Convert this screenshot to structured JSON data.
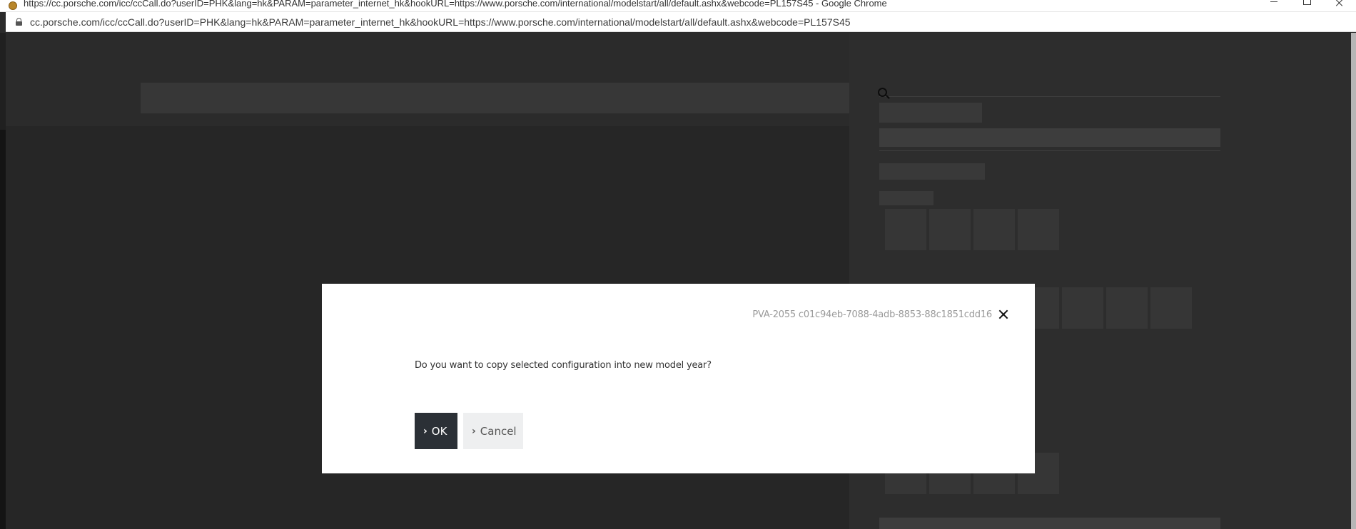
{
  "window": {
    "title": "https://cc.porsche.com/icc/ccCall.do?userID=PHK&lang=hk&PARAM=parameter_internet_hk&hookURL=https://www.porsche.com/international/modelstart/all/default.ashx&webcode=PL157S45 - Google Chrome",
    "favicon": "porsche-crest-icon"
  },
  "address_bar": {
    "url": "cc.porsche.com/icc/ccCall.do?userID=PHK&lang=hk&PARAM=parameter_internet_hk&hookURL=https://www.porsche.com/international/modelstart/all/default.ashx&webcode=PL157S45",
    "secure_icon": "lock-icon"
  },
  "page": {
    "search_icon": "search-icon"
  },
  "dialog": {
    "id_text": "PVA-2055 c01c94eb-7088-4adb-8853-88c1851cdd16",
    "question": "Do you want to copy selected configuration into new model year?",
    "ok_label": "OK",
    "cancel_label": "Cancel",
    "chevron": "›"
  },
  "colors": {
    "ok_button_bg": "#2b3036",
    "cancel_button_bg": "#eeeff0",
    "dialog_bg": "#ffffff"
  }
}
